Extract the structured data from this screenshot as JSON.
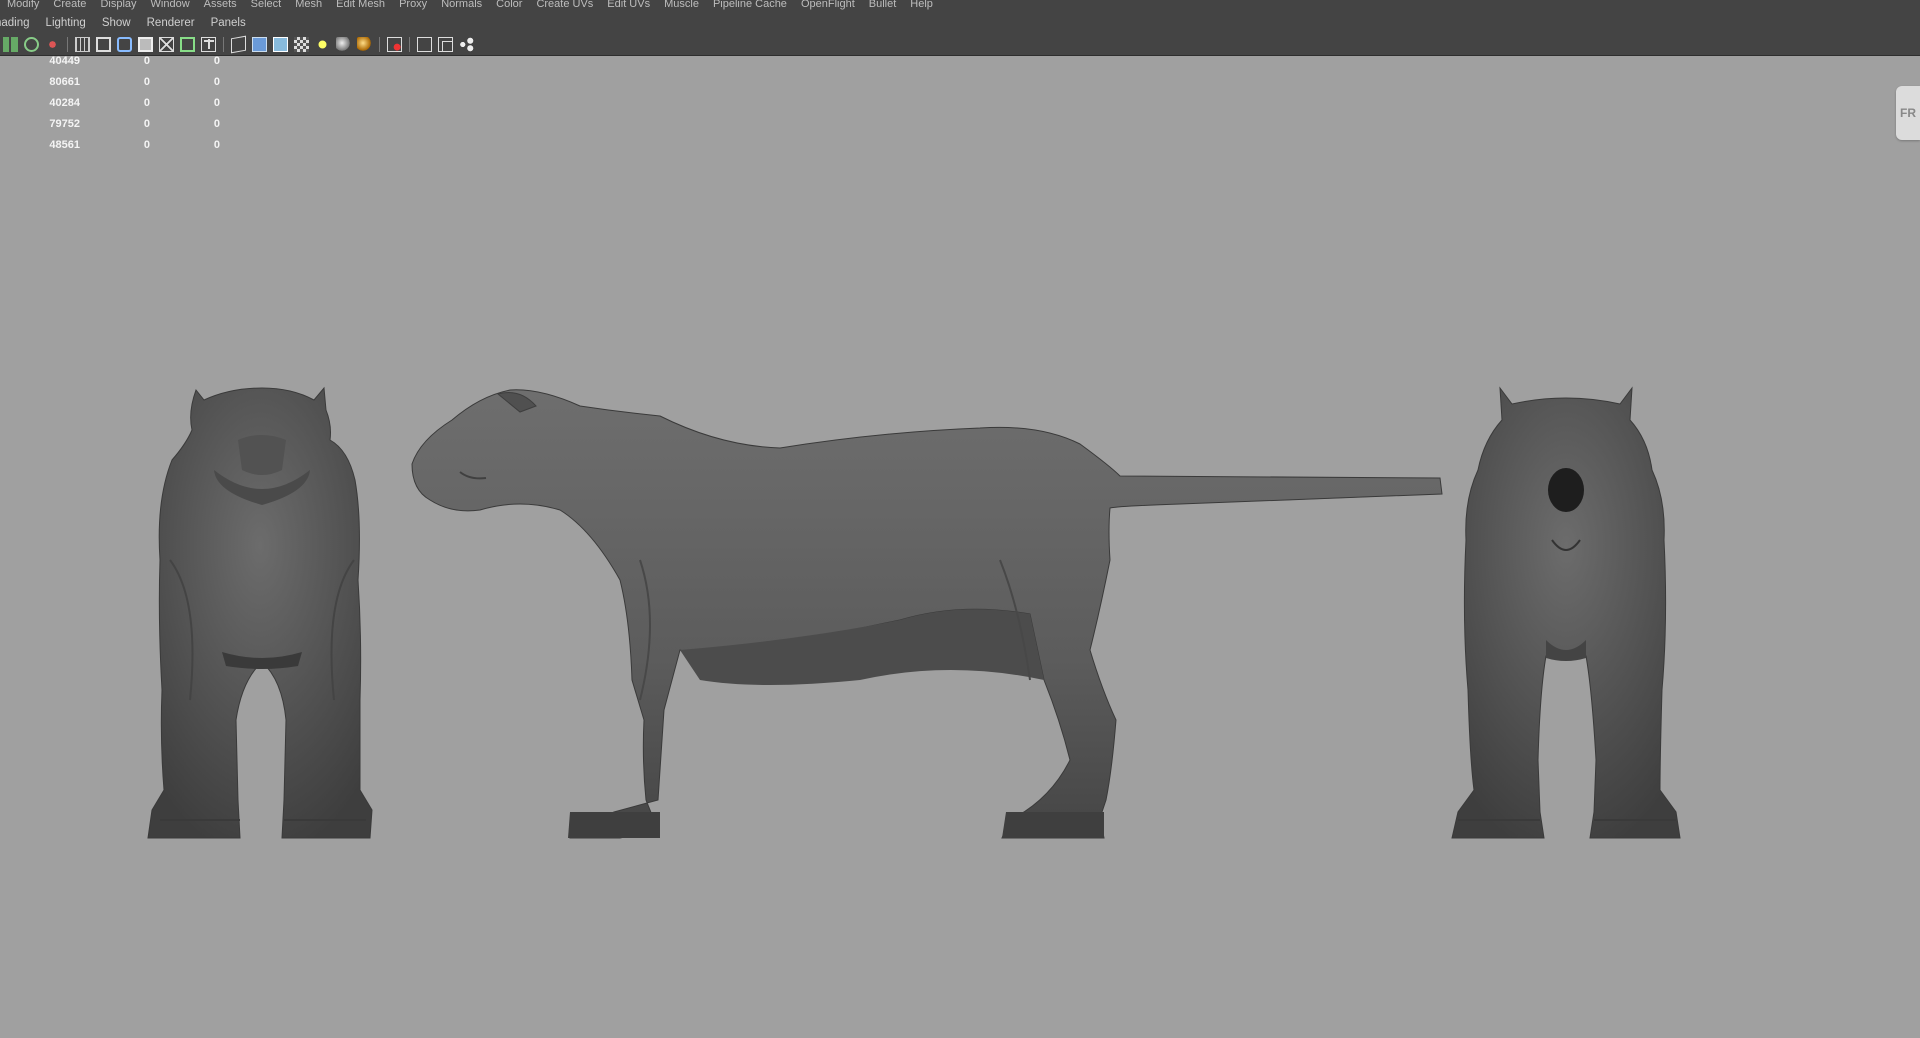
{
  "main_menu": [
    "Modify",
    "Create",
    "Display",
    "Window",
    "Assets",
    "Select",
    "Mesh",
    "Edit Mesh",
    "Proxy",
    "Normals",
    "Color",
    "Create UVs",
    "Edit UVs",
    "Muscle",
    "Pipeline Cache",
    "OpenFlight",
    "Bullet",
    "Help"
  ],
  "panel_menu": [
    "hading",
    "Lighting",
    "Show",
    "Renderer",
    "Panels"
  ],
  "hud_rows": [
    [
      "40449",
      "0",
      "0"
    ],
    [
      "80661",
      "0",
      "0"
    ],
    [
      "40284",
      "0",
      "0"
    ],
    [
      "79752",
      "0",
      "0"
    ],
    [
      "48561",
      "0",
      "0"
    ]
  ],
  "side_tab_label": "FR",
  "colors": {
    "viewport_bg": "#a0a0a0",
    "menubar_bg": "#444444",
    "model_gray": "#5e5e5e"
  }
}
